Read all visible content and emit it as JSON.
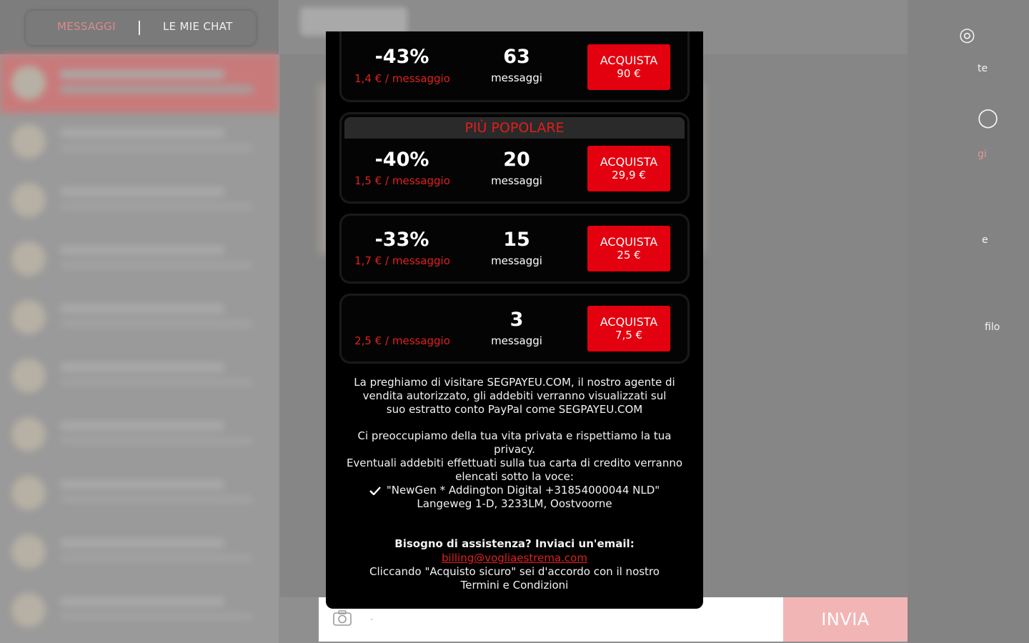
{
  "tabs": {
    "messaggi": "MESSAGGI",
    "chats": "LE MIE CHAT"
  },
  "right_panel": {
    "item1": "te",
    "item2": "gi",
    "item3": "e",
    "item4": "filo"
  },
  "bottom": {
    "send_label": "INVIA",
    "placeholder": "."
  },
  "modal": {
    "packages": [
      {
        "banner": "",
        "discount": "-43%",
        "per_message": "1,4 € / messaggio",
        "count": "63",
        "count_label": "messaggi",
        "buy_label": "ACQUISTA",
        "price": "90 €"
      },
      {
        "banner": "PIÙ POPOLARE",
        "discount": "-40%",
        "per_message": "1,5 € / messaggio",
        "count": "20",
        "count_label": "messaggi",
        "buy_label": "ACQUISTA",
        "price": "29,9 €"
      },
      {
        "banner": "",
        "discount": "-33%",
        "per_message": "1,7 € / messaggio",
        "count": "15",
        "count_label": "messaggi",
        "buy_label": "ACQUISTA",
        "price": "25 €"
      },
      {
        "banner": "",
        "discount": "",
        "per_message": "2,5 € / messaggio",
        "count": "3",
        "count_label": "messaggi",
        "buy_label": "ACQUISTA",
        "price": "7,5 €"
      }
    ],
    "agent_notice": "La preghiamo di visitare SEGPAYEU.COM, il nostro agente di vendita autorizzato, gli addebiti verranno visualizzati sul suo estratto conto PayPal come SEGPAYEU.COM",
    "privacy_line1": "Ci preoccupiamo della tua vita privata e rispettiamo la tua privacy.",
    "privacy_line2": "Eventuali addebiti effettuati sulla tua carta di credito verranno elencati sotto la voce:",
    "billing_descriptor": "\"NewGen * Addington Digital +31854000044 NLD\"",
    "billing_address": "Langeweg 1-D, 3233LM, Oostvoorne",
    "help_title": "Bisogno di assistenza? Inviaci un'email:",
    "help_email": "billing@vogliaestrema.com",
    "terms_prefix": "Cliccando \"Acquisto sicuro\" sei d'accordo con il nostro",
    "terms_link": "Termini e Condizioni"
  },
  "colors": {
    "accent": "#e3000f",
    "modal_bg": "#000000",
    "send_button": "#f2b5b5"
  }
}
